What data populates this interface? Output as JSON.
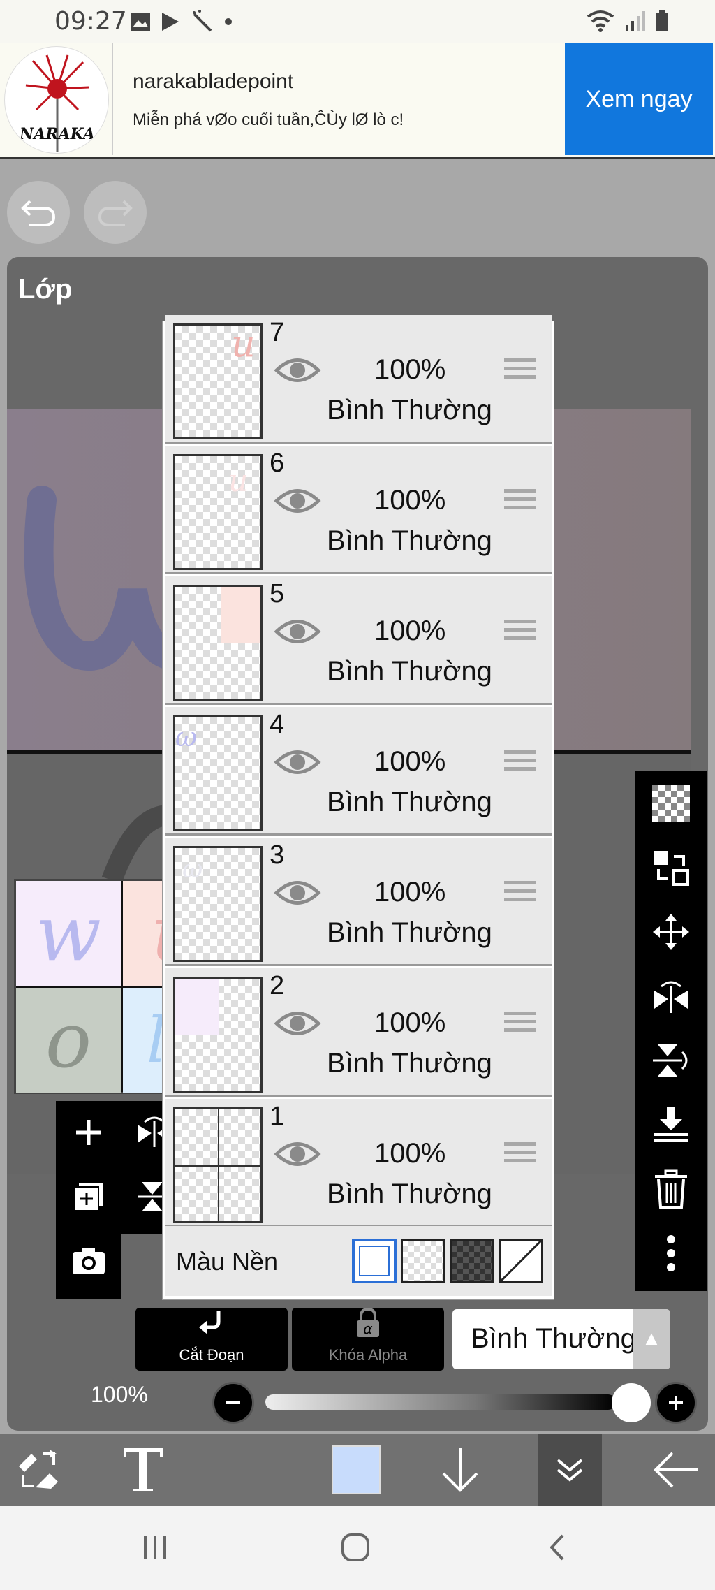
{
  "status_bar": {
    "time": "09:27",
    "icons_left": [
      "image-icon",
      "play-store-icon",
      "magic-wand-icon",
      "dot-icon"
    ],
    "icons_right": [
      "wifi-icon",
      "signal-icon",
      "battery-icon"
    ]
  },
  "ad": {
    "brand": "narakabladepoint",
    "description": "Miễn phá vØo cuối tuần,ĈÙy lØ lò c!",
    "cta": "Xem ngay",
    "logo_text": "NARAKA"
  },
  "panel": {
    "title": "Lớp"
  },
  "layers": [
    {
      "number": "7",
      "opacity": "100%",
      "mode": "Bình Thường"
    },
    {
      "number": "6",
      "opacity": "100%",
      "mode": "Bình Thường"
    },
    {
      "number": "5",
      "opacity": "100%",
      "mode": "Bình Thường"
    },
    {
      "number": "4",
      "opacity": "100%",
      "mode": "Bình Thường"
    },
    {
      "number": "3",
      "opacity": "100%",
      "mode": "Bình Thường"
    },
    {
      "number": "2",
      "opacity": "100%",
      "mode": "Bình Thường"
    },
    {
      "number": "1",
      "opacity": "100%",
      "mode": "Bình Thường"
    }
  ],
  "background_row": {
    "label": "Màu Nền",
    "selected": "white"
  },
  "thumb_grid": {
    "letters": [
      "w",
      "u",
      "o",
      "le"
    ]
  },
  "controls": {
    "clip_label": "Cắt Đoạn",
    "alpha_lock_label": "Khóa Alpha",
    "blend_mode": "Bình Thường",
    "opacity_label": "100%",
    "opacity_value": 1.0
  },
  "colors": {
    "accent": "#1177dd",
    "current_color": "#c8dcfc",
    "panel_bg": "#686868"
  }
}
